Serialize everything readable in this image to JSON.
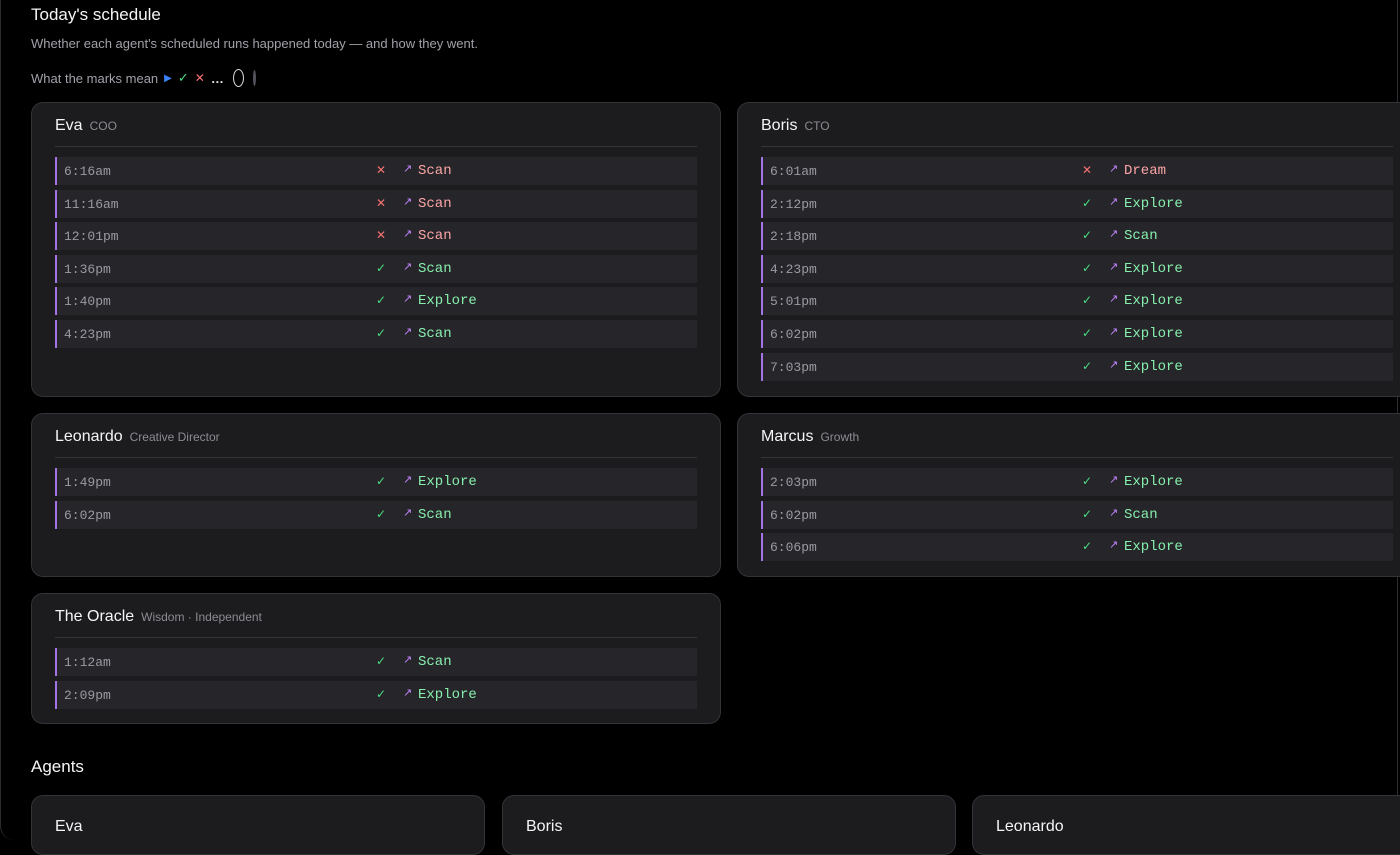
{
  "schedule": {
    "title": "Today's schedule",
    "subtitle": "Whether each agent's scheduled runs happened today — and how they went.",
    "legend_label": "What the marks mean",
    "legend_icons": [
      "play-icon",
      "check-icon",
      "x-icon",
      "ellipsis-icon",
      "ring-icon",
      "dot-icon"
    ]
  },
  "colors": {
    "ok": "#4ade80",
    "fail": "#f87171",
    "accent": "#a374e6",
    "play": "#3b82f6"
  },
  "agents_schedule": [
    {
      "name": "Eva",
      "role": "COO",
      "runs": [
        {
          "time": "6:16am",
          "status": "fail",
          "task": "Scan"
        },
        {
          "time": "11:16am",
          "status": "fail",
          "task": "Scan"
        },
        {
          "time": "12:01pm",
          "status": "fail",
          "task": "Scan"
        },
        {
          "time": "1:36pm",
          "status": "ok",
          "task": "Scan"
        },
        {
          "time": "1:40pm",
          "status": "ok",
          "task": "Explore"
        },
        {
          "time": "4:23pm",
          "status": "ok",
          "task": "Scan"
        }
      ]
    },
    {
      "name": "Boris",
      "role": "CTO",
      "runs": [
        {
          "time": "6:01am",
          "status": "fail",
          "task": "Dream"
        },
        {
          "time": "2:12pm",
          "status": "ok",
          "task": "Explore"
        },
        {
          "time": "2:18pm",
          "status": "ok",
          "task": "Scan"
        },
        {
          "time": "4:23pm",
          "status": "ok",
          "task": "Explore"
        },
        {
          "time": "5:01pm",
          "status": "ok",
          "task": "Explore"
        },
        {
          "time": "6:02pm",
          "status": "ok",
          "task": "Explore"
        },
        {
          "time": "7:03pm",
          "status": "ok",
          "task": "Explore"
        }
      ]
    },
    {
      "name": "Leonardo",
      "role": "Creative Director",
      "runs": [
        {
          "time": "1:49pm",
          "status": "ok",
          "task": "Explore"
        },
        {
          "time": "6:02pm",
          "status": "ok",
          "task": "Scan"
        }
      ]
    },
    {
      "name": "Marcus",
      "role": "Growth",
      "runs": [
        {
          "time": "2:03pm",
          "status": "ok",
          "task": "Explore"
        },
        {
          "time": "6:02pm",
          "status": "ok",
          "task": "Scan"
        },
        {
          "time": "6:06pm",
          "status": "ok",
          "task": "Explore"
        }
      ]
    },
    {
      "name": "The Oracle",
      "role": "Wisdom · Independent",
      "runs": [
        {
          "time": "1:12am",
          "status": "ok",
          "task": "Scan"
        },
        {
          "time": "2:09pm",
          "status": "ok",
          "task": "Explore"
        }
      ]
    }
  ],
  "agents_section": {
    "title": "Agents",
    "cards": [
      {
        "name": "Eva"
      },
      {
        "name": "Boris"
      },
      {
        "name": "Leonardo"
      }
    ]
  }
}
